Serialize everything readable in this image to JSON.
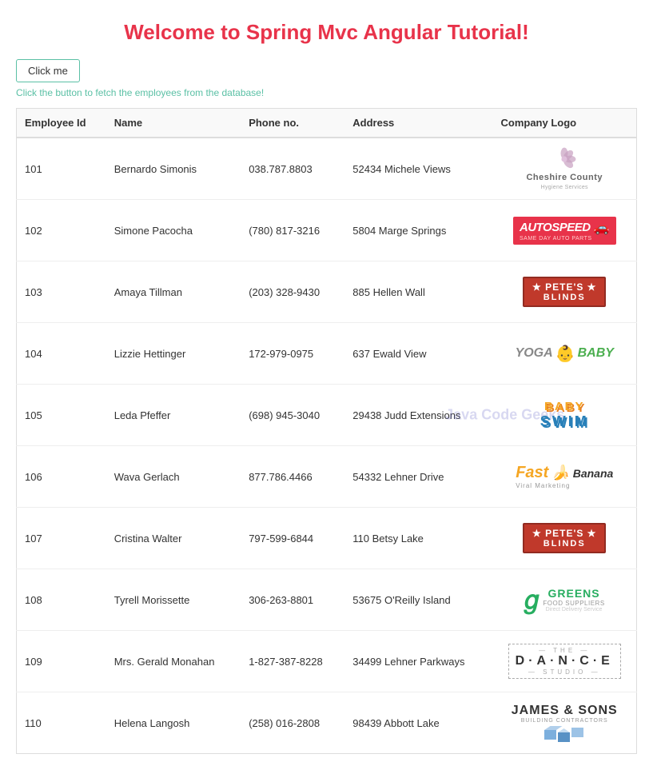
{
  "page": {
    "title": "Welcome to Spring Mvc Angular Tutorial!",
    "button_label": "Click me",
    "hint": "Click the button to fetch the employees from the database!"
  },
  "table": {
    "headers": [
      "Employee Id",
      "Name",
      "Phone no.",
      "Address",
      "Company Logo"
    ],
    "rows": [
      {
        "id": "101",
        "name": "Bernardo Simonis",
        "phone": "038.787.8803",
        "address": "52434 Michele Views",
        "logo_type": "cheshire"
      },
      {
        "id": "102",
        "name": "Simone Pacocha",
        "phone": "(780) 817-3216",
        "address": "5804 Marge Springs",
        "logo_type": "autospeed"
      },
      {
        "id": "103",
        "name": "Amaya Tillman",
        "phone": "(203) 328-9430",
        "address": "885 Hellen Wall",
        "logo_type": "petes"
      },
      {
        "id": "104",
        "name": "Lizzie Hettinger",
        "phone": "172-979-0975",
        "address": "637 Ewald View",
        "logo_type": "yogababy"
      },
      {
        "id": "105",
        "name": "Leda Pfeffer",
        "phone": "(698) 945-3040",
        "address": "29438 Judd Extensions",
        "logo_type": "babyswim"
      },
      {
        "id": "106",
        "name": "Wava Gerlach",
        "phone": "877.786.4466",
        "address": "54332 Lehner Drive",
        "logo_type": "fastbanana"
      },
      {
        "id": "107",
        "name": "Cristina Walter",
        "phone": "797-599-6844",
        "address": "110 Betsy Lake",
        "logo_type": "petes2"
      },
      {
        "id": "108",
        "name": "Tyrell Morissette",
        "phone": "306-263-8801",
        "address": "53675 O'Reilly Island",
        "logo_type": "greens"
      },
      {
        "id": "109",
        "name": "Mrs. Gerald Monahan",
        "phone": "1-827-387-8228",
        "address": "34499 Lehner Parkways",
        "logo_type": "dance"
      },
      {
        "id": "110",
        "name": "Helena Langosh",
        "phone": "(258) 016-2808",
        "address": "98439 Abbott Lake",
        "logo_type": "james"
      }
    ]
  }
}
